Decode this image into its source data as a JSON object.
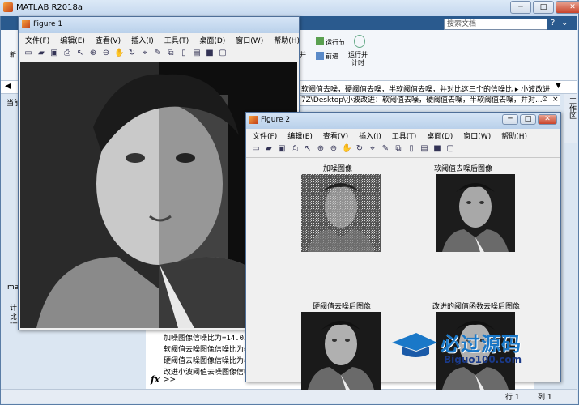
{
  "main": {
    "title": "MATLAB R2018a",
    "search_placeholder": "搜索文档",
    "ribbon": {
      "run_section": "运行节",
      "advance": "前进",
      "run_and_time": "运行并\n计时",
      "run_and": "并"
    },
    "left_labels": {
      "new": "新",
      "current": "当前",
      "ma": "ma",
      "ji": "计",
      "bi": "比",
      "dashes": "---"
    },
    "addr_text": "软阈值去噪，硬阈值去噪，半软阈值去噪，并对比这三个的信噪比 ▸ 小波改进",
    "path_text": "80127Z\\Desktop\\小波改进：软阈值去噪，硬阈值去噪，半软阈值去噪，并对...",
    "workspace_tab": "工作区",
    "cmd_lines": [
      "加噪图像信噪比为=14.03",
      "软阈值去噪图像信噪比为=",
      "硬阈值去噪图像信噪比为=",
      "改进小波阈值去噪图像信噪"
    ],
    "prompt_fx": "fx",
    "prompt": ">>",
    "status": {
      "row": "行 1",
      "col": "列 1"
    }
  },
  "fig1": {
    "title": "Figure 1",
    "menu": [
      "文件(F)",
      "编辑(E)",
      "查看(V)",
      "插入(I)",
      "工具(T)",
      "桌面(D)",
      "窗口(W)",
      "帮助(H)"
    ]
  },
  "fig2": {
    "title": "Figure 2",
    "menu": [
      "文件(F)",
      "编辑(E)",
      "查看(V)",
      "插入(I)",
      "工具(T)",
      "桌面(D)",
      "窗口(W)",
      "帮助(H)"
    ],
    "subplots": [
      "加噪图像",
      "软阈值去噪后图像",
      "硬阈值去噪后图像",
      "改进的阈值函数去噪后图像"
    ]
  },
  "watermark": {
    "big": "必过源码",
    "small": "Biguo100.com"
  },
  "icons": [
    "new-file-icon",
    "open-icon",
    "save-icon",
    "print-icon",
    "pointer-icon",
    "zoom-in-icon",
    "zoom-out-icon",
    "pan-icon",
    "rotate-icon",
    "datatip-icon",
    "brush-icon",
    "link-icon",
    "colorbar-icon",
    "legend-icon",
    "hide-icon",
    "show-icon"
  ]
}
